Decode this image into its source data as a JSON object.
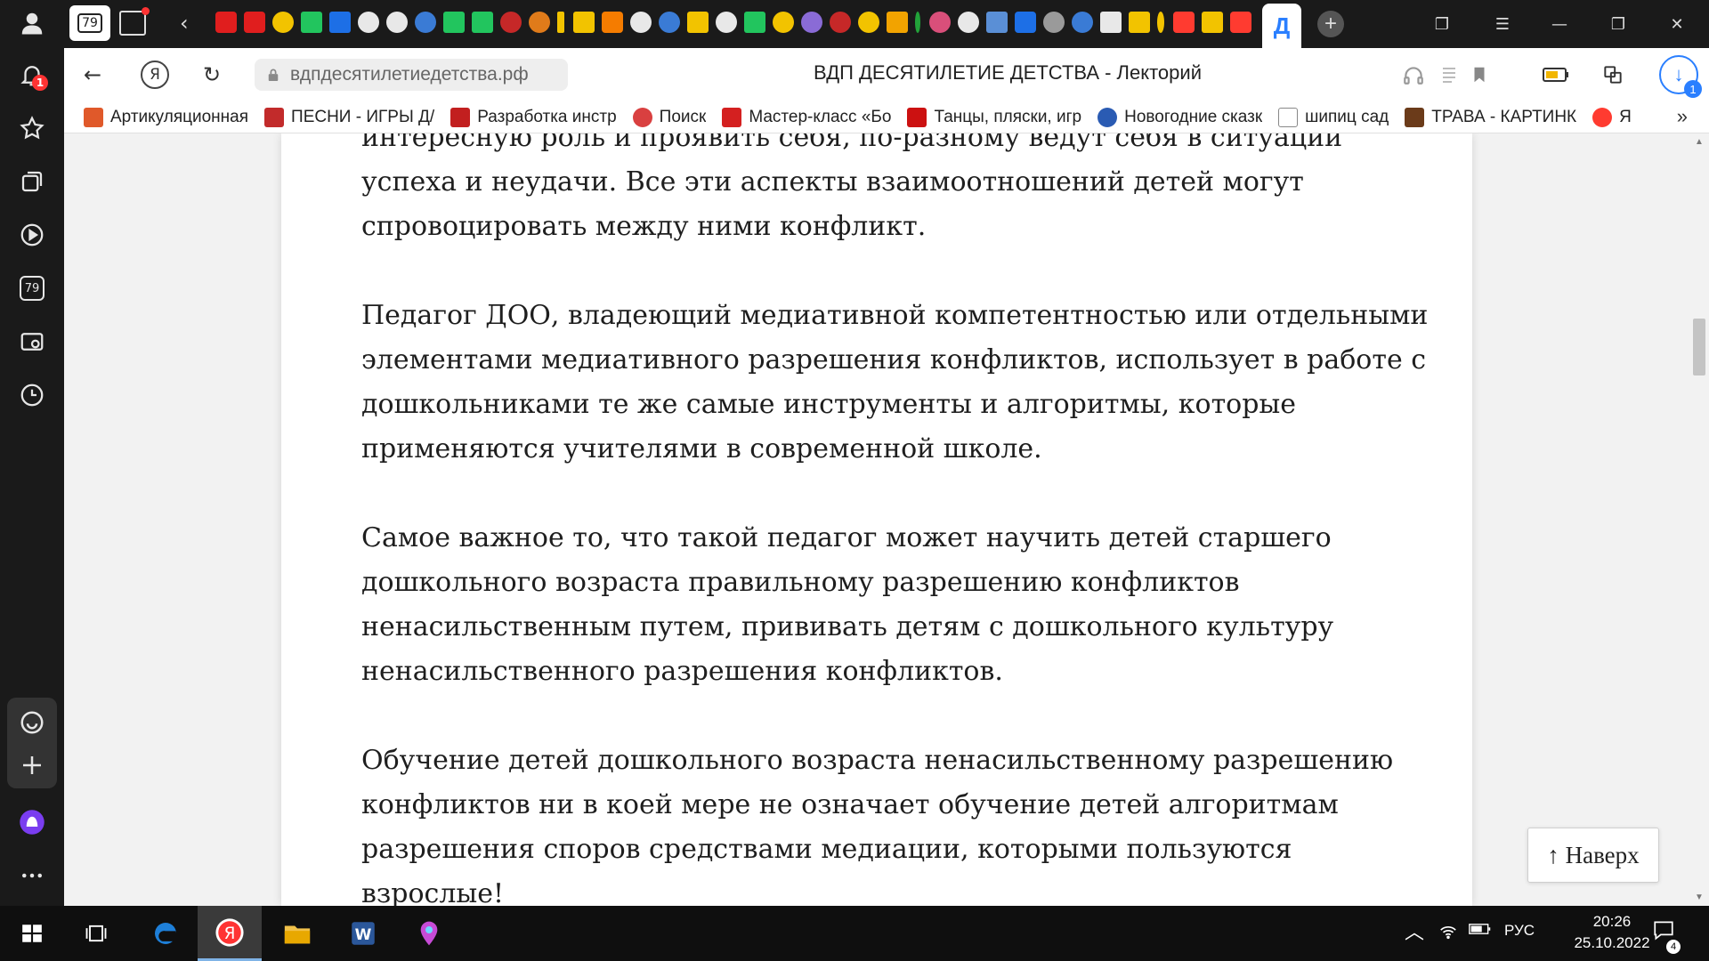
{
  "sidebar": {
    "notifications_badge": "1",
    "tabs_count": "79"
  },
  "tabstrip": {
    "home_tab_count": "79",
    "active_tab_letter": "Д"
  },
  "addressbar": {
    "url": "вдпдесятилетиедетства.рф",
    "title": "ВДП ДЕСЯТИЛЕТИЕ ДЕТСТВА - Лекторий",
    "download_badge": "1"
  },
  "bookmarks": [
    {
      "label": "Артикуляционная",
      "color": "#e0592a"
    },
    {
      "label": "ПЕСНИ - ИГРЫ Д/",
      "color": "#c22b2b"
    },
    {
      "label": "Разработка инстр",
      "color": "#c21f1f"
    },
    {
      "label": "Поиск",
      "color": "#d94040"
    },
    {
      "label": "Мастер-класс «Бо",
      "color": "#d42020"
    },
    {
      "label": "Танцы, пляски, игр",
      "color": "#cc1111"
    },
    {
      "label": "Новогодние сказк",
      "color": "#2a5bb3"
    },
    {
      "label": "шипиц сад",
      "color": "#888888"
    },
    {
      "label": "ТРАВА - КАРТИНК",
      "color": "#6b3b1a"
    },
    {
      "label": "Я",
      "color": "#ff3b30"
    }
  ],
  "article": {
    "paragraphs": [
      "интересную роль и проявить себя, по-разному ведут себя в ситуации успеха и неудачи. Все эти аспекты взаимоотношений детей могут спровоцировать между ними конфликт.",
      "Педагог ДОО, владеющий медиативной компетентностью или отдельными элементами медиативного разрешения конфликтов, использует в работе с дошкольниками те же самые инструменты и алгоритмы, которые применяются учителями в современной школе.",
      "Самое важное то, что такой педагог может научить детей старшего дошкольного возраста правильному разрешению конфликтов ненасильственным путем, прививать детям с дошкольного культуру ненасильственного разрешения конфликтов.",
      "Обучение детей дошкольного возраста ненасильственному разрешению конфликтов ни в коей мере не означает обучение детей алгоритмам разрешения споров средствами медиации, которыми пользуются взрослые!"
    ],
    "to_top_label": "↑ Наверх"
  },
  "taskbar": {
    "language": "РУС",
    "time": "20:26",
    "date": "25.10.2022",
    "notifications": "4"
  }
}
